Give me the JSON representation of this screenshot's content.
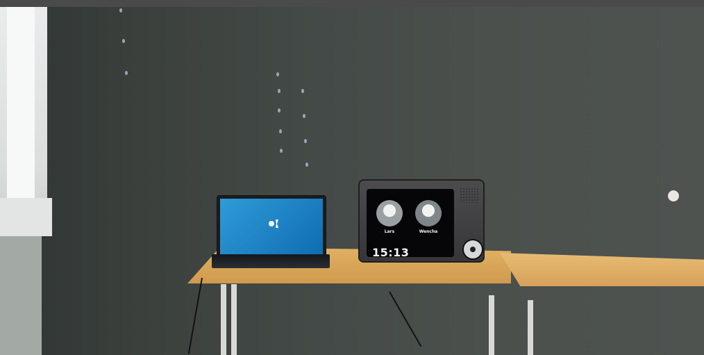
{
  "laptop": {
    "caption": ""
  },
  "device": {
    "contacts": [
      {
        "name": "Lars"
      },
      {
        "name": "Wencha"
      }
    ],
    "time": "15:13"
  }
}
